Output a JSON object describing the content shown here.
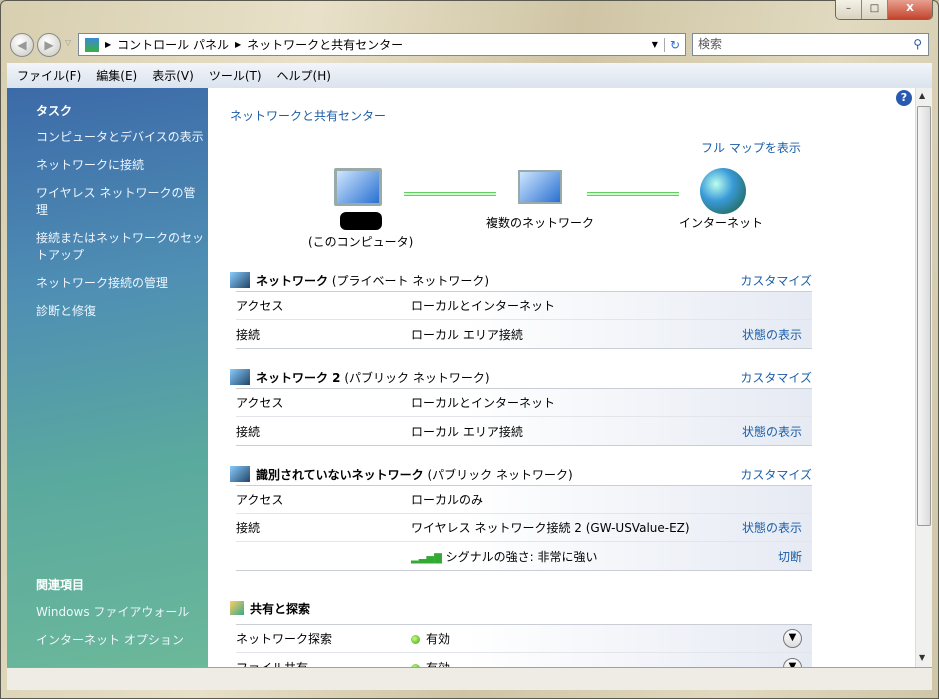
{
  "window": {
    "minimize": "–",
    "maximize": "□",
    "close": "X"
  },
  "address": {
    "crumbs": [
      "コントロール パネル",
      "ネットワークと共有センター"
    ],
    "search_placeholder": "検索"
  },
  "menu": [
    "ファイル(F)",
    "編集(E)",
    "表示(V)",
    "ツール(T)",
    "ヘルプ(H)"
  ],
  "sidebar": {
    "tasks_title": "タスク",
    "tasks": [
      "コンピュータとデバイスの表示",
      "ネットワークに接続",
      "ワイヤレス ネットワークの管理",
      "接続またはネットワークのセットアップ",
      "ネットワーク接続の管理",
      "診断と修復"
    ],
    "related_title": "関連項目",
    "related": [
      "Windows ファイアウォール",
      "インターネット オプション"
    ]
  },
  "main": {
    "title": "ネットワークと共有センター",
    "full_map": "フル マップを表示",
    "map": {
      "computer_sub": "(このコンピュータ)",
      "multi": "複数のネットワーク",
      "internet": "インターネット"
    },
    "networks": [
      {
        "name": "ネットワーク",
        "type": "(プライベート ネットワーク)",
        "customize": "カスタマイズ",
        "access_label": "アクセス",
        "access": "ローカルとインターネット",
        "conn_label": "接続",
        "conn": "ローカル エリア接続",
        "status": "状態の表示"
      },
      {
        "name": "ネットワーク 2",
        "type": "(パブリック ネットワーク)",
        "customize": "カスタマイズ",
        "access_label": "アクセス",
        "access": "ローカルとインターネット",
        "conn_label": "接続",
        "conn": "ローカル エリア接続",
        "status": "状態の表示"
      },
      {
        "name": "識別されていないネットワーク",
        "type": "(パブリック ネットワーク)",
        "customize": "カスタマイズ",
        "access_label": "アクセス",
        "access": "ローカルのみ",
        "conn_label": "接続",
        "conn": "ワイヤレス ネットワーク接続 2 (GW-USValue-EZ)",
        "status": "状態の表示",
        "signal": "シグナルの強さ: 非常に強い",
        "disconnect": "切断"
      }
    ],
    "sharing": {
      "title": "共有と探索",
      "rows": [
        {
          "label": "ネットワーク探索",
          "value": "有効"
        },
        {
          "label": "ファイル共有",
          "value": "有効"
        }
      ]
    }
  }
}
